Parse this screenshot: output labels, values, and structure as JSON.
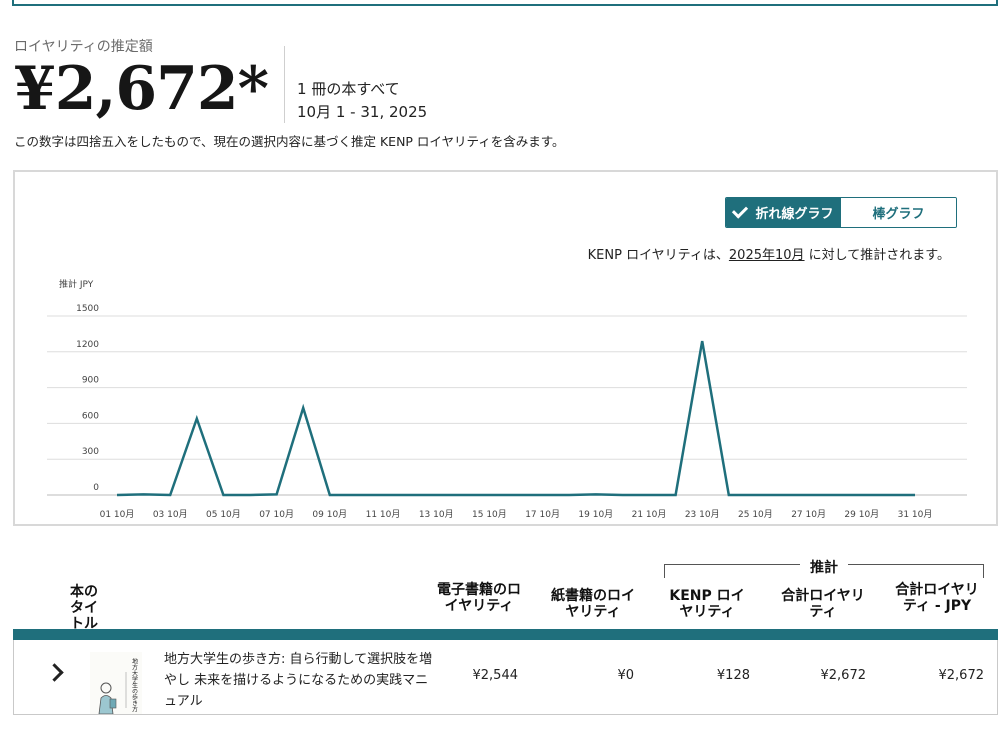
{
  "summary": {
    "label": "ロイヤリティの推定額",
    "amount": "¥2,672*",
    "scope": "1 冊の本すべて",
    "date_range": "10月 1 - 31, 2025",
    "note": "この数字は四捨五入をしたもので、現在の選択内容に基づく推定 KENP ロイヤリティを含みます。"
  },
  "toggle": {
    "line": "折れ線グラフ",
    "bar": "棒グラフ",
    "selected": "line"
  },
  "chart_note": {
    "prefix": "KENP ロイヤリティは、",
    "month": "2025年10月",
    "suffix": " に対して推計されます。"
  },
  "chart_data": {
    "type": "line",
    "ylabel": "推計 JPY",
    "ylim": [
      0,
      1500
    ],
    "yticks": [
      0,
      300,
      600,
      900,
      1200,
      1500
    ],
    "x": [
      1,
      2,
      3,
      4,
      5,
      6,
      7,
      8,
      9,
      10,
      11,
      12,
      13,
      14,
      15,
      16,
      17,
      18,
      19,
      20,
      21,
      22,
      23,
      24,
      25,
      26,
      27,
      28,
      29,
      30,
      31
    ],
    "xtick_labels": [
      "01 10月",
      "03 10月",
      "05 10月",
      "07 10月",
      "09 10月",
      "11 10月",
      "13 10月",
      "15 10月",
      "17 10月",
      "19 10月",
      "21 10月",
      "23 10月",
      "25 10月",
      "27 10月",
      "29 10月",
      "31 10月"
    ],
    "series": [
      {
        "values": [
          0,
          5,
          0,
          640,
          0,
          0,
          5,
          730,
          0,
          0,
          0,
          0,
          0,
          0,
          0,
          0,
          0,
          0,
          5,
          0,
          0,
          0,
          1290,
          0,
          0,
          0,
          0,
          0,
          0,
          0,
          0
        ],
        "color": "#1f6f7c"
      }
    ],
    "grid": true
  },
  "table": {
    "group_label": "推計",
    "columns": {
      "title": "本のタイトル",
      "ebook": "電子書籍のロイヤリティ",
      "paper": "紙書籍のロイヤリティ",
      "kenp": "KENP ロイヤリティ",
      "total": "合計ロイヤリティ",
      "total_jpy": "合計ロイヤリティ - JPY"
    },
    "rows": [
      {
        "title": "地方大学生の歩き方: 自ら行動して選択肢を増やし 未来を描けるようになるための実践マニュアル",
        "cover_text": "地方大学生の歩き方",
        "ebook": "¥2,544",
        "paper": "¥0",
        "kenp": "¥128",
        "total": "¥2,672",
        "total_jpy": "¥2,672"
      }
    ]
  },
  "colors": {
    "accent": "#1f6f7c",
    "grid": "#dddddd"
  }
}
